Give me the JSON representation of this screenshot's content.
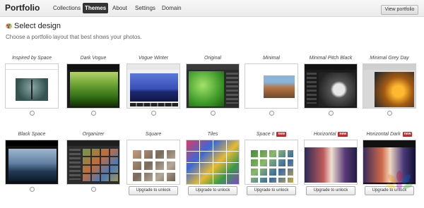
{
  "header": {
    "app_title": "Portfolio",
    "nav": [
      "Collections",
      "Themes",
      "About",
      "Settings",
      "Domain"
    ],
    "active_nav": "Themes",
    "view_button": "View portfolio"
  },
  "main": {
    "title": "Select design",
    "subtitle": "Choose a portfolio layout that best shows your photos."
  },
  "themes": [
    {
      "name": "Inspired by Space",
      "new": false
    },
    {
      "name": "Dark Vogue",
      "new": false
    },
    {
      "name": "Vogue Winter",
      "new": false
    },
    {
      "name": "Original",
      "new": false
    },
    {
      "name": "Minimal",
      "new": false
    },
    {
      "name": "Minimal Pitch Black",
      "new": false
    },
    {
      "name": "Minimal Grey Day",
      "new": false
    },
    {
      "name": "Black Space",
      "new": false
    },
    {
      "name": "Organizer",
      "new": false
    },
    {
      "name": "Square",
      "new": false,
      "unlock": "Upgrade to unlock"
    },
    {
      "name": "Tiles",
      "new": false,
      "unlock": "Upgrade to unlock"
    },
    {
      "name": "Space II",
      "new": true,
      "unlock": "Upgrade to unlock"
    },
    {
      "name": "Horizontal",
      "new": true,
      "unlock": "Upgrade to unlock"
    },
    {
      "name": "Horizontal Dark",
      "new": true,
      "unlock": "Upgrade to unlock"
    }
  ],
  "badge_label": "new",
  "colors": {
    "active_nav_bg": "#333333",
    "badge": "#d42323"
  }
}
